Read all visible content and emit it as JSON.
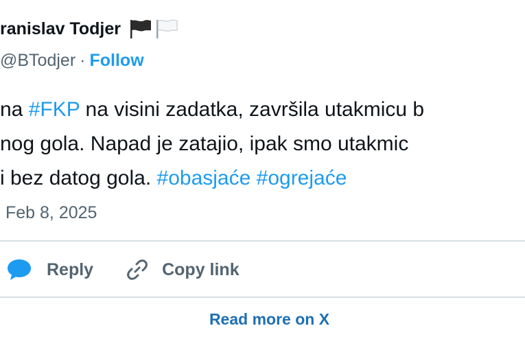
{
  "author": {
    "name": "ranislav Todjer",
    "handle": "@BTodjer",
    "separator": "·",
    "follow_label": "Follow"
  },
  "tweet": {
    "line1": {
      "pre": "na ",
      "tag": "#FKP",
      "post": " na visini zadatka, završila utakmicu b"
    },
    "line2": "nog gola. Napad je zatajio, ipak smo utakmic",
    "line3": {
      "pre": " i bez datog gola. ",
      "tag1": "#obasjaće",
      "space": " ",
      "tag2": "#ogrejaće"
    }
  },
  "date": "Feb 8, 2025",
  "actions": {
    "reply_label": "Reply",
    "copy_link_label": "Copy link"
  },
  "read_more_label": "Read more on X",
  "colors": {
    "accent": "#1d9bf0",
    "reply_icon": "#1d9bf0",
    "muted": "#536471"
  },
  "icons": {
    "flag_1": "black-flag-icon",
    "flag_2": "white-flag-icon",
    "reply": "speech-bubble-icon",
    "copy_link": "link-icon"
  }
}
